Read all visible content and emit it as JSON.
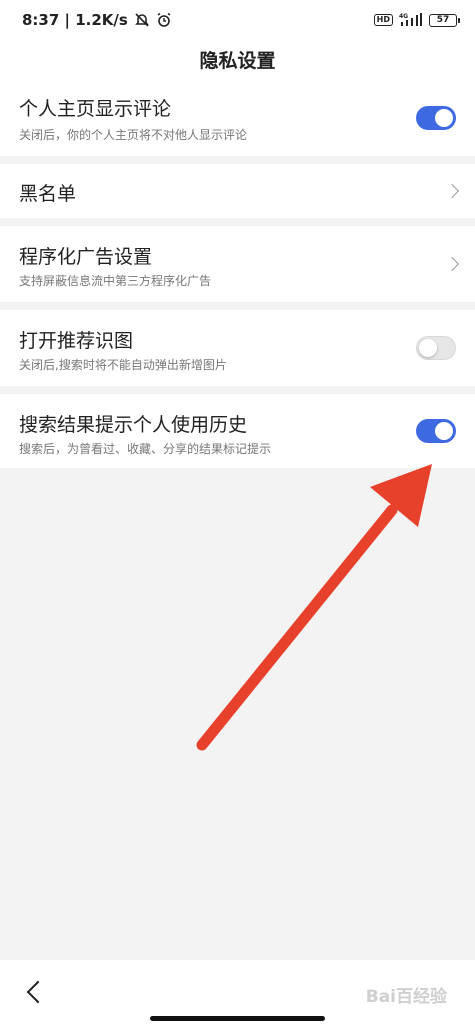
{
  "status_bar": {
    "time_speed": "8:37 | 1.2K/s",
    "hd_label": "HD",
    "network_label": "4G",
    "battery": "57",
    "icons": [
      "mute-bell-icon",
      "alarm-icon",
      "signal-icon",
      "battery-icon"
    ]
  },
  "header": {
    "title": "隐私设置"
  },
  "settings": [
    {
      "title": "个人主页显示评论",
      "subtitle": "关闭后，你的个人主页将不对他人显示评论",
      "control": "toggle",
      "on": true
    },
    {
      "title": "黑名单",
      "subtitle": "",
      "control": "chevron"
    },
    {
      "title": "程序化广告设置",
      "subtitle": "支持屏蔽信息流中第三方程序化广告",
      "control": "chevron"
    },
    {
      "title": "打开推荐识图",
      "subtitle": "关闭后,搜索时将不能自动弹出新增图片",
      "control": "toggle",
      "on": false
    },
    {
      "title": "搜索结果提示个人使用历史",
      "subtitle": "搜索后，为曾看过、收藏、分享的结果标记提示",
      "control": "toggle",
      "on": true
    }
  ],
  "nav": {
    "back_icon": "back-chevron-icon"
  },
  "watermark": "Bai百经验",
  "colors": {
    "toggle_on": "#3e6ae1",
    "arrow": "#e8412b",
    "background": "#f3f3f3"
  }
}
